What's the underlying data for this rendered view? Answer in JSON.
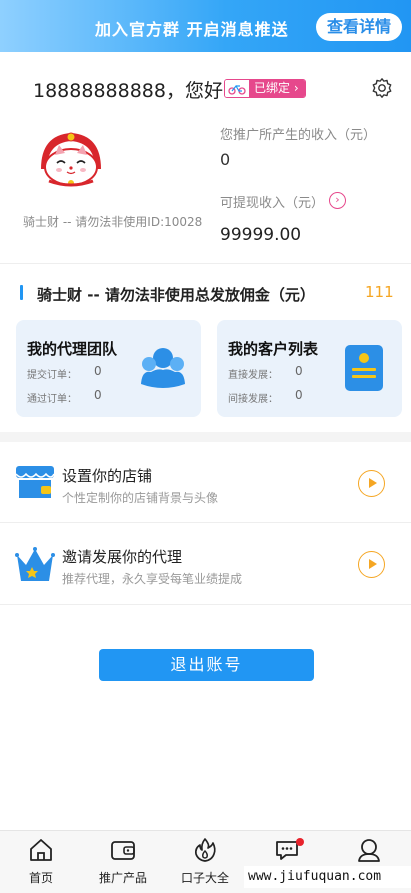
{
  "banner": {
    "text": "加入官方群 开启消息推送",
    "button_label": "查看详情"
  },
  "profile": {
    "greeting": "18888888888，您好",
    "bound_label": "已绑定",
    "avatar": "lucky-cat-avatar",
    "note": "骑士财 -- 请勿法非使用ID:10028"
  },
  "income": {
    "promo_label": "您推广所产生的收入（元）",
    "promo_value": "0",
    "withdraw_label": "可提现收入（元）",
    "withdraw_value": "99999.00"
  },
  "commission": {
    "title": "骑士财 -- 请勿法非使用总发放佣金（元）",
    "value": "111"
  },
  "cards": {
    "team": {
      "title": "我的代理团队",
      "rows": [
        {
          "label": "提交订单：",
          "value": "0"
        },
        {
          "label": "通过订单：",
          "value": "0"
        }
      ]
    },
    "customers": {
      "title": "我的客户列表",
      "rows": [
        {
          "label": "直接发展：",
          "value": "0"
        },
        {
          "label": "间接发展：",
          "value": "0"
        }
      ]
    }
  },
  "menu": {
    "shop": {
      "title": "设置你的店铺",
      "subtitle": "个性定制你的店铺背景与头像"
    },
    "agent": {
      "title": "邀请发展你的代理",
      "subtitle": "推荐代理，永久享受每笔业绩提成"
    }
  },
  "logout_label": "退出账号",
  "tabs": [
    "首页",
    "推广产品",
    "口子大全",
    "",
    ""
  ],
  "watermark": "www.jiufuquan.com",
  "colors": {
    "accent": "#2196f3",
    "badge": "#e6488c",
    "highlight": "#f5a623"
  }
}
